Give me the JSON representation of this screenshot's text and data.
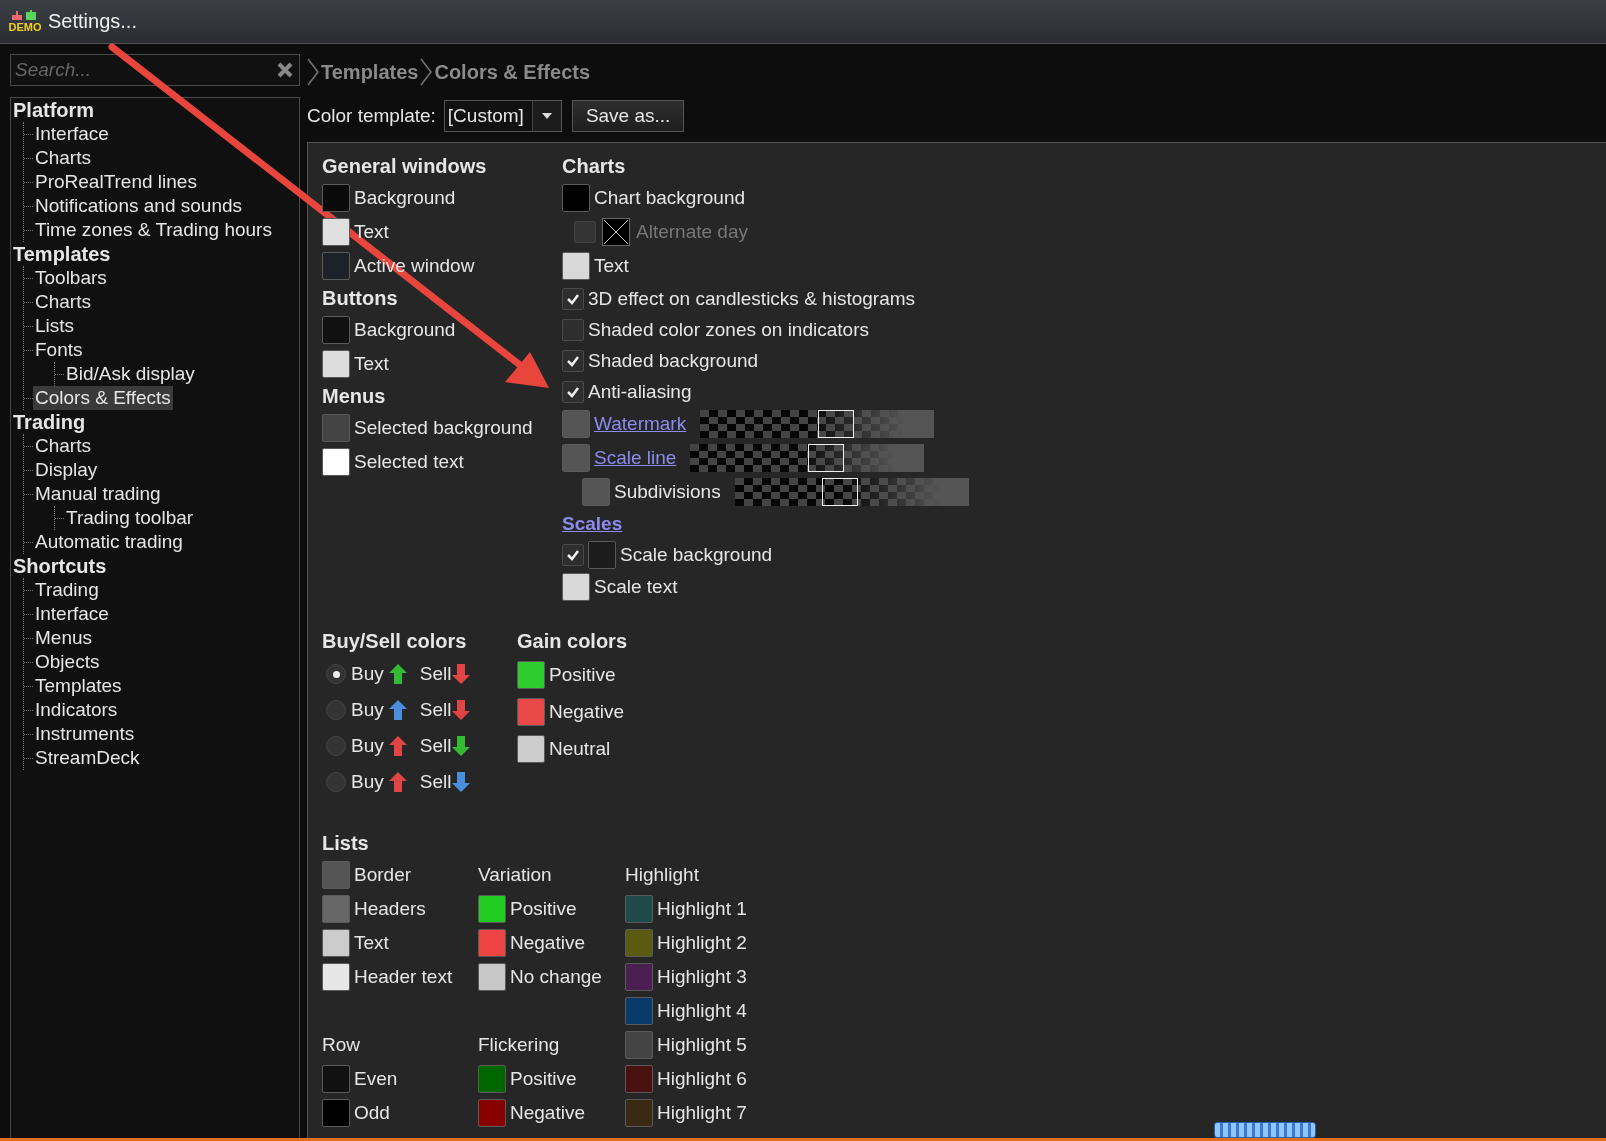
{
  "window": {
    "title": "Settings...",
    "badge": "DEMO"
  },
  "search": {
    "placeholder": "Search..."
  },
  "breadcrumb": [
    "Templates",
    "Colors & Effects"
  ],
  "tree": [
    {
      "label": "Platform",
      "children": [
        {
          "label": "Interface",
          "selected": false
        },
        {
          "label": "Charts",
          "selected": false
        },
        {
          "label": "ProRealTrend lines",
          "selected": false
        },
        {
          "label": "Notifications and sounds",
          "selected": false
        },
        {
          "label": "Time zones & Trading hours",
          "selected": false
        }
      ]
    },
    {
      "label": "Templates",
      "children": [
        {
          "label": "Toolbars",
          "selected": false
        },
        {
          "label": "Charts",
          "selected": false
        },
        {
          "label": "Lists",
          "selected": false
        },
        {
          "label": "Fonts",
          "selected": false,
          "children": [
            {
              "label": "Bid/Ask display",
              "selected": false
            }
          ]
        },
        {
          "label": "Colors & Effects",
          "selected": true
        }
      ]
    },
    {
      "label": "Trading",
      "children": [
        {
          "label": "Charts",
          "selected": false
        },
        {
          "label": "Display",
          "selected": false
        },
        {
          "label": "Manual trading",
          "selected": false,
          "children": [
            {
              "label": "Trading toolbar",
              "selected": false
            }
          ]
        },
        {
          "label": "Automatic trading",
          "selected": false
        }
      ]
    },
    {
      "label": "Shortcuts",
      "children": [
        {
          "label": "Trading",
          "selected": false
        },
        {
          "label": "Interface",
          "selected": false
        },
        {
          "label": "Menus",
          "selected": false
        },
        {
          "label": "Objects",
          "selected": false
        },
        {
          "label": "Templates",
          "selected": false
        },
        {
          "label": "Indicators",
          "selected": false
        },
        {
          "label": "Instruments",
          "selected": false
        },
        {
          "label": "StreamDeck",
          "selected": false
        }
      ]
    }
  ],
  "color_template": {
    "label": "Color template:",
    "value": "[Custom]",
    "button": "Save as..."
  },
  "left_groups": [
    {
      "title": "General windows",
      "items": [
        {
          "label": "Background",
          "color": "#0a0a0a"
        },
        {
          "label": "Text",
          "color": "#e0e0e0"
        },
        {
          "label": "Active window",
          "color": "#1c2228"
        }
      ]
    },
    {
      "title": "Buttons",
      "items": [
        {
          "label": "Background",
          "color": "#111111"
        },
        {
          "label": "Text",
          "color": "#dddddd"
        }
      ]
    },
    {
      "title": "Menus",
      "items": [
        {
          "label": "Selected background",
          "color": "#444444"
        },
        {
          "label": "Selected text",
          "color": "#ffffff"
        }
      ]
    }
  ],
  "charts": {
    "title": "Charts",
    "items": [
      {
        "kind": "swatch",
        "label": "Chart background",
        "color": "#000000"
      },
      {
        "kind": "crossed",
        "label": "Alternate day",
        "checked": false,
        "disabled": true
      },
      {
        "kind": "swatch",
        "label": "Text",
        "color": "#d8d8d8"
      },
      {
        "kind": "check",
        "label": "3D effect on candlesticks & histograms",
        "checked": true
      },
      {
        "kind": "check",
        "label": "Shaded color zones on indicators",
        "checked": false
      },
      {
        "kind": "check",
        "label": "Shaded background",
        "checked": true
      },
      {
        "kind": "check",
        "label": "Anti-aliasing",
        "checked": true
      },
      {
        "kind": "scale",
        "label": "Watermark",
        "color": "#555555",
        "level": 0.58
      },
      {
        "kind": "scale",
        "label": "Scale line",
        "color": "#555555",
        "level": 0.58
      },
      {
        "kind": "subscale",
        "label": "Subdivisions",
        "color": "#555555",
        "level": 0.45
      },
      {
        "kind": "link_heading",
        "label": "Scales"
      },
      {
        "kind": "check_swatch",
        "label": "Scale background",
        "checked": true,
        "color": "#1c1c1c"
      },
      {
        "kind": "swatch",
        "label": "Scale text",
        "color": "#d8d8d8"
      }
    ]
  },
  "buy_sell": {
    "title": "Buy/Sell colors",
    "options": [
      {
        "selected": true,
        "buy": {
          "label": "Buy",
          "color": "#33bb33"
        },
        "sell": {
          "label": "Sell",
          "color": "#e04444"
        }
      },
      {
        "selected": false,
        "buy": {
          "label": "Buy",
          "color": "#4a8ee0"
        },
        "sell": {
          "label": "Sell",
          "color": "#e04444"
        }
      },
      {
        "selected": false,
        "buy": {
          "label": "Buy",
          "color": "#e04444"
        },
        "sell": {
          "label": "Sell",
          "color": "#33bb33"
        }
      },
      {
        "selected": false,
        "buy": {
          "label": "Buy",
          "color": "#e04444"
        },
        "sell": {
          "label": "Sell",
          "color": "#4a8ee0"
        }
      }
    ]
  },
  "gain": {
    "title": "Gain colors",
    "items": [
      {
        "label": "Positive",
        "color": "#2ecc2e"
      },
      {
        "label": "Negative",
        "color": "#e84848"
      },
      {
        "label": "Neutral",
        "color": "#cccccc"
      }
    ]
  },
  "lists": {
    "title": "Lists",
    "columns": [
      [
        {
          "items": [
            {
              "label": "Border",
              "color": "#555555"
            },
            {
              "label": "Headers",
              "color": "#666666"
            },
            {
              "label": "Text",
              "color": "#cccccc"
            },
            {
              "label": "Header text",
              "color": "#e6e6e6"
            }
          ]
        },
        {
          "title": "Row",
          "items": [
            {
              "label": "Even",
              "color": "#111111"
            },
            {
              "label": "Odd",
              "color": "#000000"
            }
          ]
        }
      ],
      [
        {
          "title": "Variation",
          "items": [
            {
              "label": "Positive",
              "color": "#22cc22"
            },
            {
              "label": "Negative",
              "color": "#ee4444"
            },
            {
              "label": "No change",
              "color": "#c8c8c8"
            }
          ]
        },
        {
          "title": "Flickering",
          "items": [
            {
              "label": "Positive",
              "color": "#006600"
            },
            {
              "label": "Negative",
              "color": "#880000"
            }
          ]
        }
      ],
      [
        {
          "title": "Highlight",
          "items": [
            {
              "label": "Highlight 1",
              "color": "#1e4a4a"
            },
            {
              "label": "Highlight 2",
              "color": "#5a5a10"
            },
            {
              "label": "Highlight 3",
              "color": "#4a2050"
            },
            {
              "label": "Highlight 4",
              "color": "#083a6a"
            },
            {
              "label": "Highlight 5",
              "color": "#444444"
            },
            {
              "label": "Highlight 6",
              "color": "#4a1010"
            },
            {
              "label": "Highlight 7",
              "color": "#3a2a14"
            }
          ]
        }
      ]
    ]
  }
}
